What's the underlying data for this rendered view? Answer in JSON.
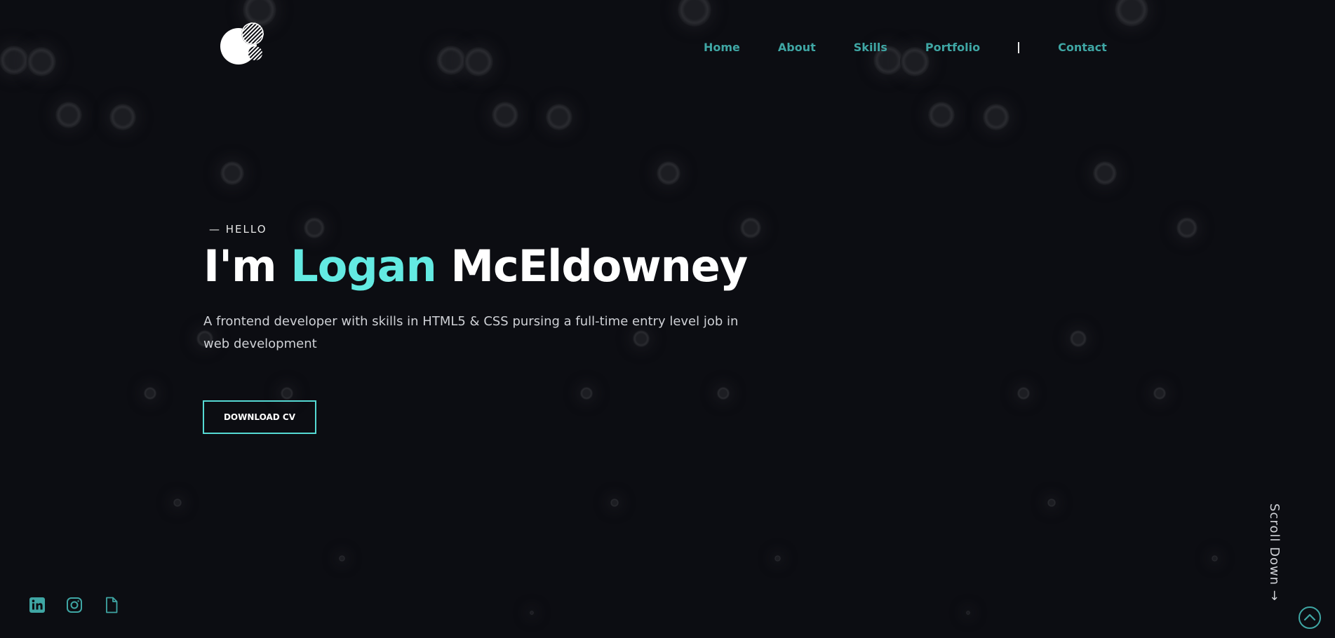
{
  "header": {
    "logo_icon": "circles-logo-icon",
    "nav": {
      "home": "Home",
      "about": "About",
      "skills": "Skills",
      "portfolio": "Portfolio",
      "contact": "Contact"
    }
  },
  "hero": {
    "eyebrow": "— HELLO",
    "headline_prefix": "I'm",
    "headline_first": "Logan",
    "headline_last": "McEldowney",
    "tagline": "A frontend developer with skills in HTML5 & CSS pursing a full-time entry level job in web development",
    "button_label": "DOWNLOAD CV"
  },
  "social": {
    "icons": [
      "linkedin-icon",
      "instagram-icon",
      "document-icon"
    ]
  },
  "scroll": {
    "label": "Scroll Down →",
    "to_top_icon": "chevron-up-circle-icon"
  },
  "colors": {
    "background": "#0c0d12",
    "accent": "#63eae2",
    "nav": "#3fa6a4",
    "button_border": "#55d9d3"
  }
}
